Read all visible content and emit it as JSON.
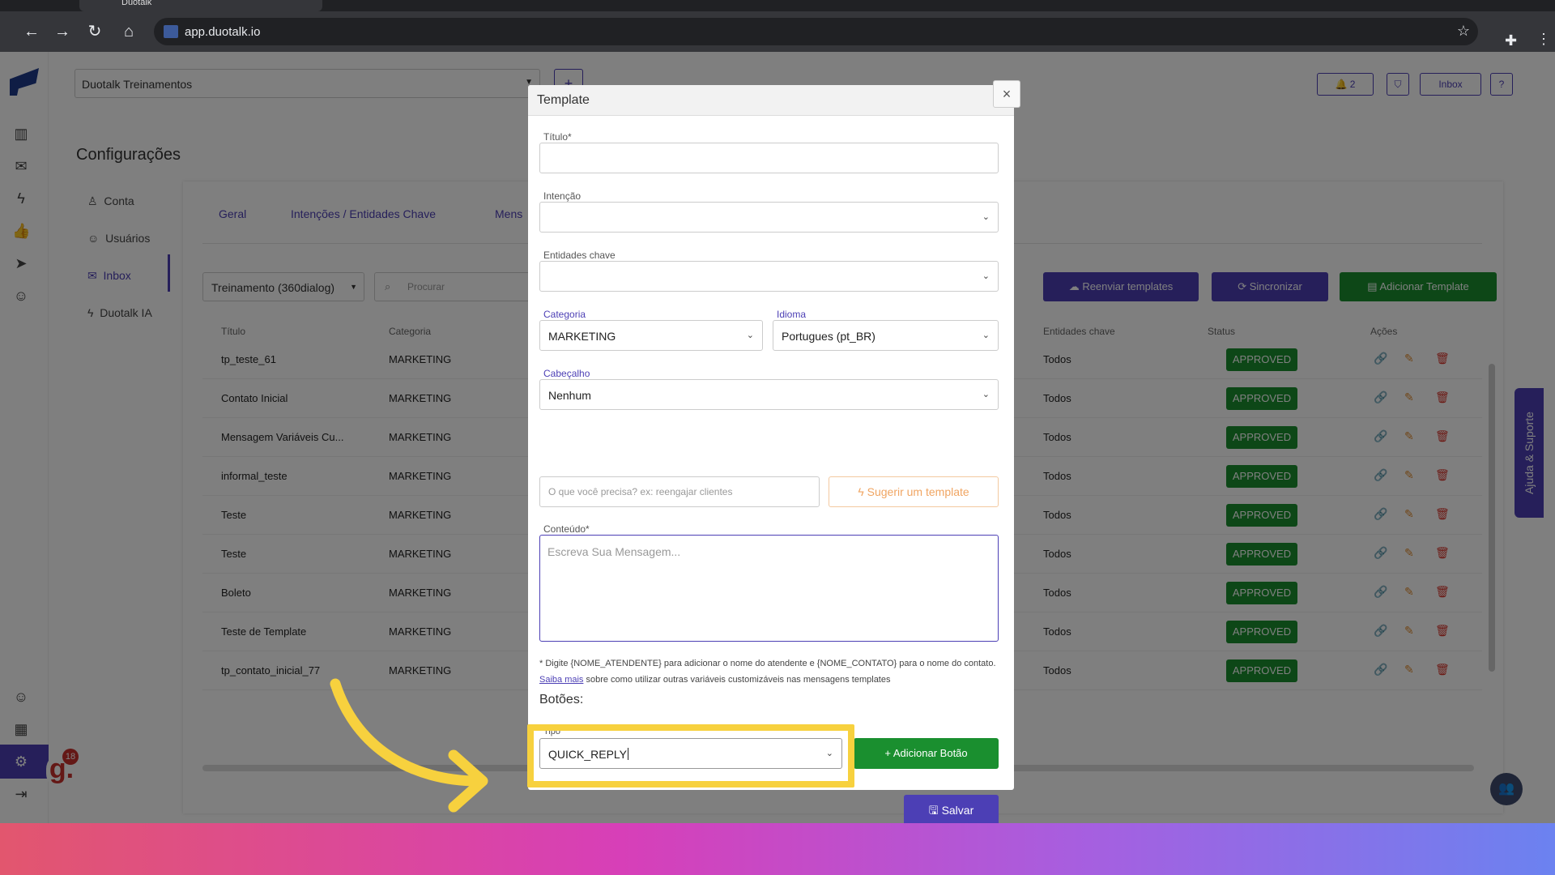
{
  "browser": {
    "tab_title": "Duotalk",
    "url": "app.duotalk.io"
  },
  "header": {
    "workspace": "Duotalk Treinamentos",
    "notif_count": "2",
    "inbox_label": "Inbox",
    "help_label": "?"
  },
  "page": {
    "title": "Configurações",
    "nav": [
      "Conta",
      "Usuários",
      "Inbox",
      "Duotalk IA"
    ],
    "tabs": [
      "Geral",
      "Intenções / Entidades Chave",
      "Mens"
    ]
  },
  "toolbar": {
    "filter": "Treinamento (360dialog)",
    "search_placeholder": "Procurar",
    "resend": "Reenviar templates",
    "sync": "Sincronizar",
    "add_template": "Adicionar Template"
  },
  "table": {
    "headers": [
      "Título",
      "Categoria",
      "Entidades chave",
      "Status",
      "Ações"
    ],
    "rows": [
      {
        "title": "tp_teste_61",
        "category": "MARKETING",
        "entities": "Todos",
        "status": "APPROVED"
      },
      {
        "title": "Contato Inicial",
        "category": "MARKETING",
        "entities": "Todos",
        "status": "APPROVED"
      },
      {
        "title": "Mensagem Variáveis Cu...",
        "category": "MARKETING",
        "entities": "Todos",
        "status": "APPROVED"
      },
      {
        "title": "informal_teste",
        "category": "MARKETING",
        "entities": "Todos",
        "status": "APPROVED"
      },
      {
        "title": "Teste",
        "category": "MARKETING",
        "entities": "Todos",
        "status": "APPROVED"
      },
      {
        "title": "Teste",
        "category": "MARKETING",
        "entities": "Todos",
        "status": "APPROVED"
      },
      {
        "title": "Boleto",
        "category": "MARKETING",
        "entities": "Todos",
        "status": "APPROVED"
      },
      {
        "title": "Teste de Template",
        "category": "MARKETING",
        "entities": "Todos",
        "status": "APPROVED"
      },
      {
        "title": "tp_contato_inicial_77",
        "category": "MARKETING",
        "entities": "Todos",
        "status": "APPROVED"
      }
    ]
  },
  "help_tab": "Ajuda & Suporte",
  "badge": {
    "letter": "g.",
    "count": "18"
  },
  "modal": {
    "title": "Template",
    "close": "×",
    "titulo_label": "Título*",
    "intencao_label": "Intenção",
    "entidades_label": "Entidades chave",
    "categoria_label": "Categoria",
    "categoria_value": "MARKETING",
    "idioma_label": "Idioma",
    "idioma_value": "Portugues (pt_BR)",
    "cabecalho_label": "Cabeçalho",
    "cabecalho_value": "Nenhum",
    "ai_placeholder": "O que você precisa? ex: reengajar clientes",
    "suggest_label": "Sugerir um template",
    "conteudo_label": "Conteúdo*",
    "conteudo_placeholder": "Escreva Sua Mensagem...",
    "note_prefix": "* Digite {NOME_ATENDENTE} para adicionar o nome do atendente e {NOME_CONTATO} para o nome do contato.",
    "note_link": "Saiba mais",
    "note_suffix": "sobre como utilizar outras variáveis customizáveis nas mensagens templates",
    "buttons_title": "Botões:",
    "tipo_label": "Tipo",
    "tipo_value": "QUICK_REPLY",
    "add_button": "Adicionar Botão",
    "save": "Salvar"
  },
  "colors": {
    "brand": "#4c3fb5",
    "success": "#1a8f2f",
    "highlight": "#f7d13e"
  }
}
